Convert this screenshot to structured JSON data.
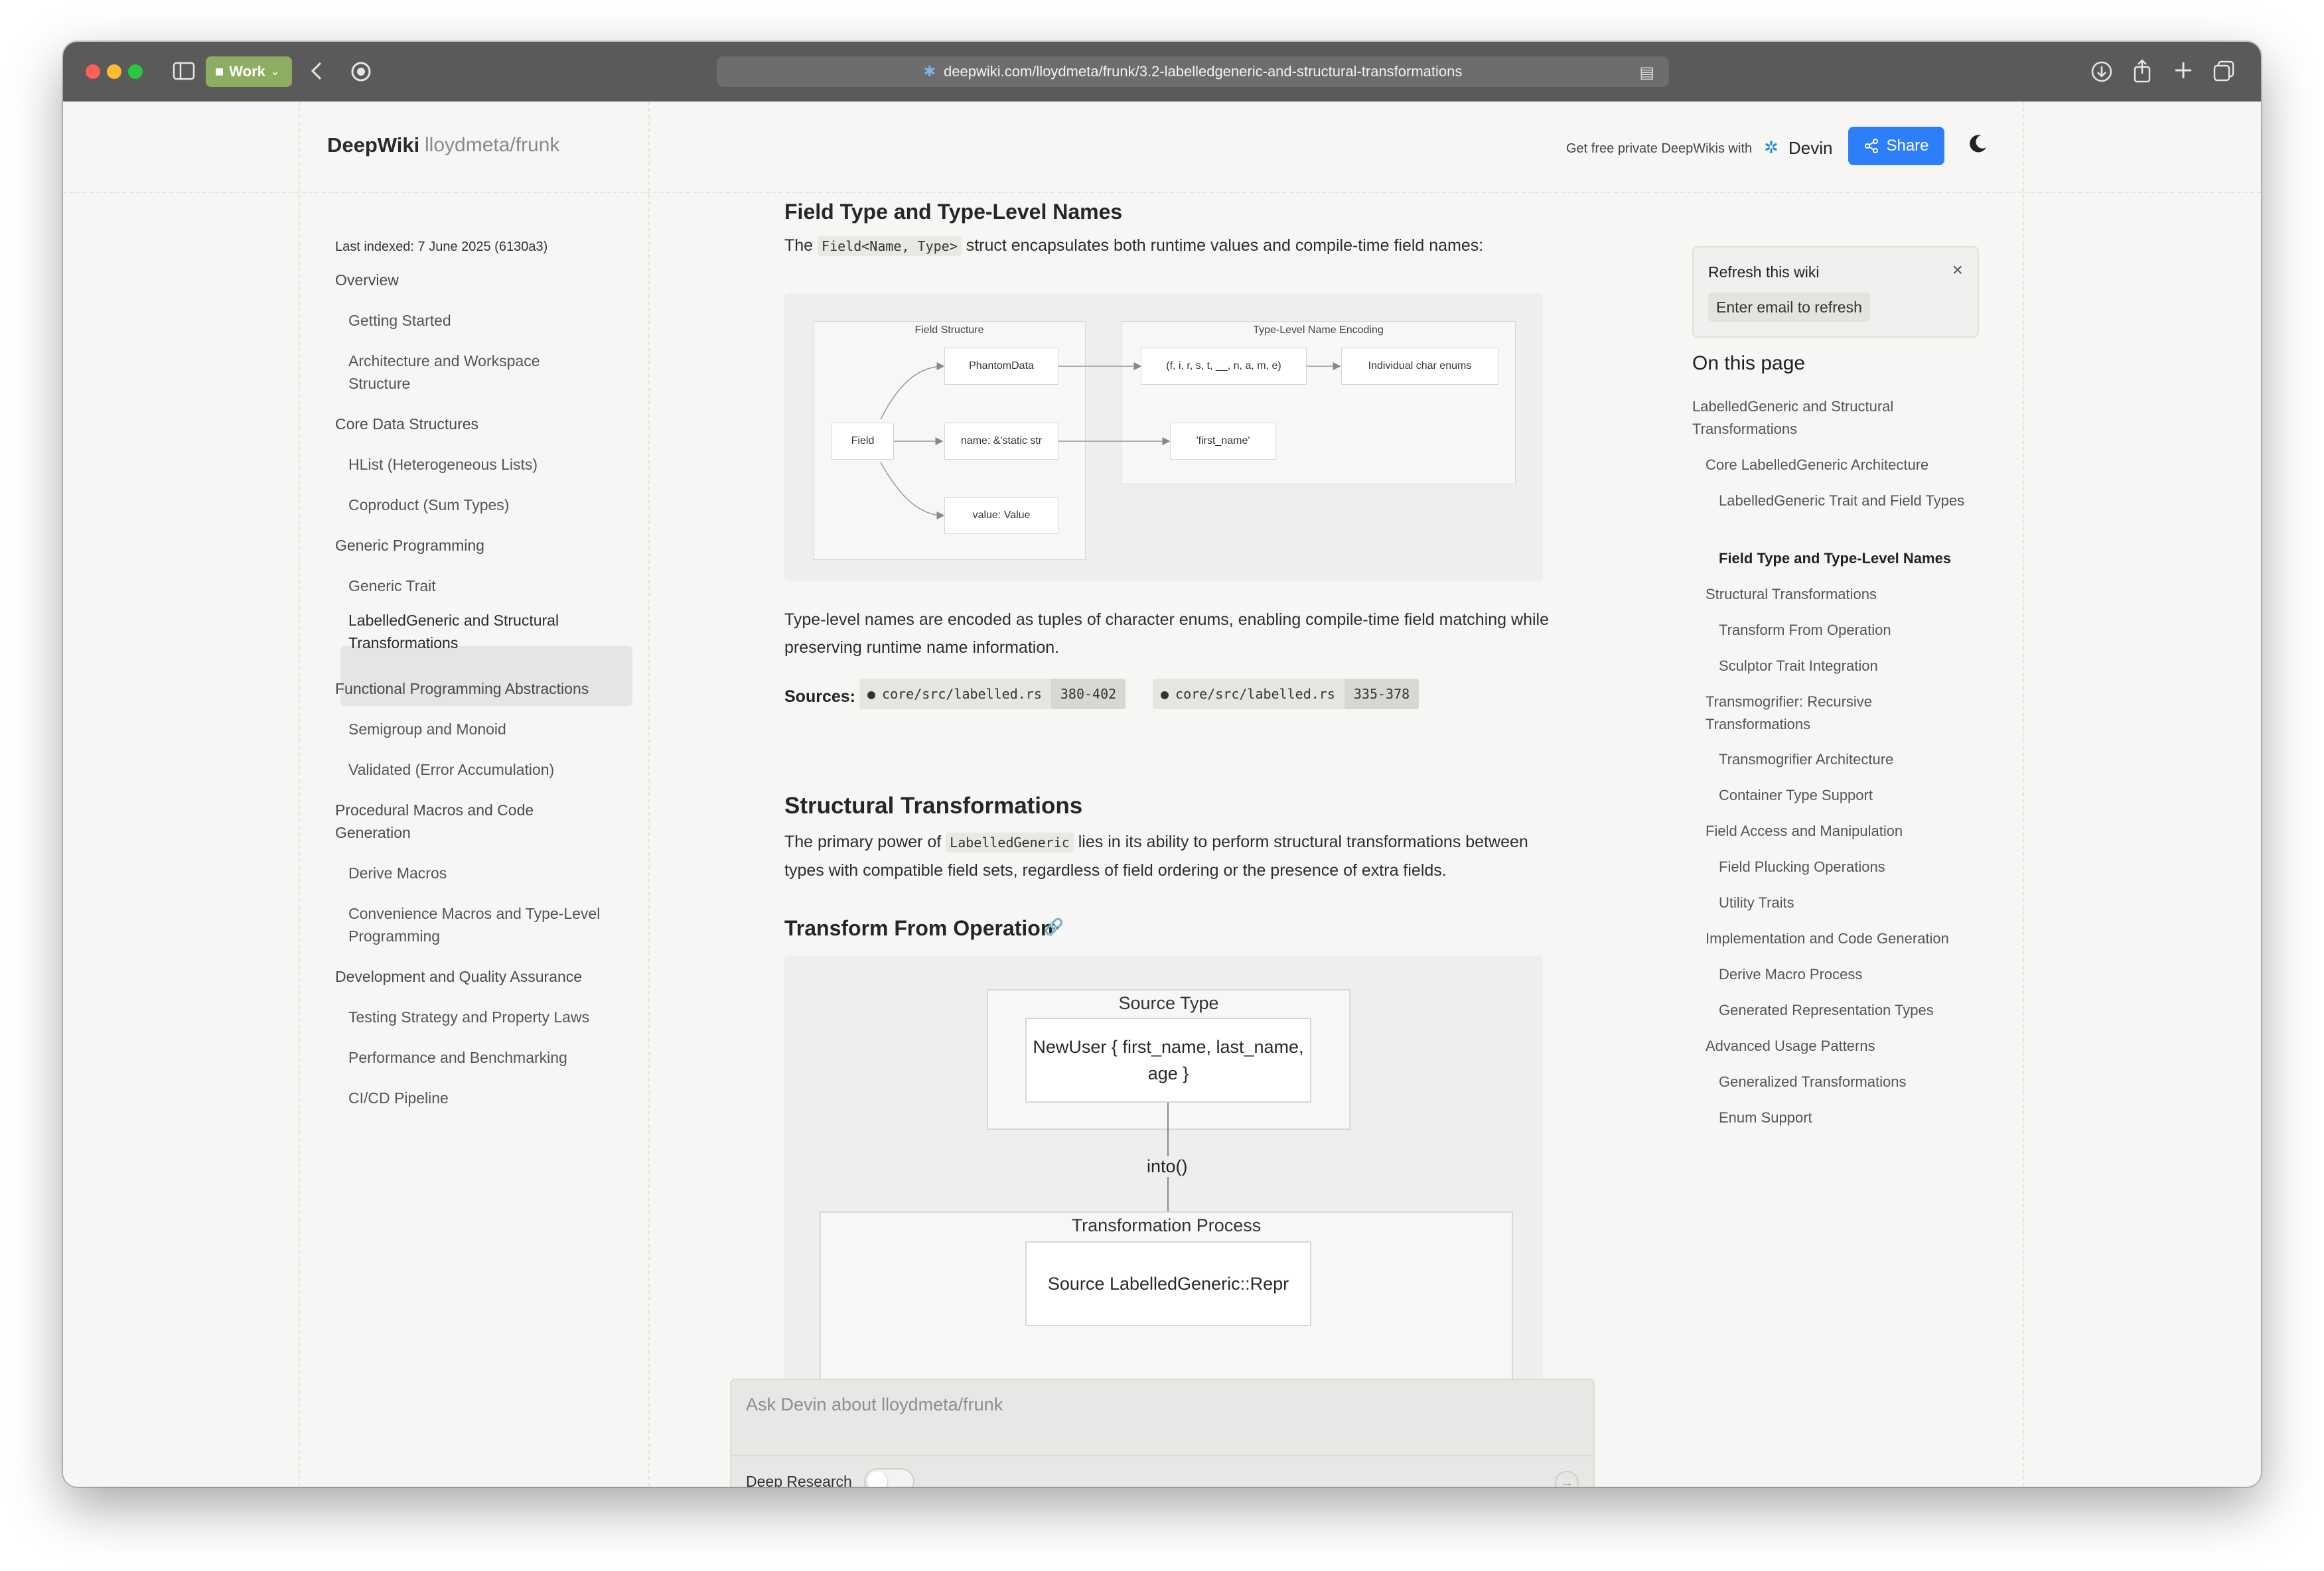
{
  "browser": {
    "profile_label": "Work",
    "url": "deepwiki.com/lloydmeta/frunk/3.2-labelledgeneric-and-structural-transformations"
  },
  "header": {
    "brand": "DeepWiki",
    "repo": "lloydmeta/frunk",
    "promo": "Get free private DeepWikis with",
    "devin": "Devin",
    "share": "Share"
  },
  "sidebar": {
    "last_indexed": "Last indexed: 7 June 2025 (6130a3)",
    "items": [
      {
        "label": "Overview"
      },
      {
        "label": "Getting Started"
      },
      {
        "label": "Architecture and Workspace Structure"
      },
      {
        "label": "Core Data Structures"
      },
      {
        "label": "HList (Heterogeneous Lists)"
      },
      {
        "label": "Coproduct (Sum Types)"
      },
      {
        "label": "Generic Programming"
      },
      {
        "label": "Generic Trait"
      },
      {
        "label": "LabelledGeneric and Structural Transformations"
      },
      {
        "label": "Functional Programming Abstractions"
      },
      {
        "label": "Semigroup and Monoid"
      },
      {
        "label": "Validated (Error Accumulation)"
      },
      {
        "label": "Procedural Macros and Code Generation"
      },
      {
        "label": "Derive Macros"
      },
      {
        "label": "Convenience Macros and Type-Level Programming"
      },
      {
        "label": "Development and Quality Assurance"
      },
      {
        "label": "Testing Strategy and Property Laws"
      },
      {
        "label": "Performance and Benchmarking"
      },
      {
        "label": "CI/CD Pipeline"
      }
    ]
  },
  "content": {
    "section1": {
      "title": "Field Type and Type-Level Names",
      "intro_pre": "The",
      "intro_code": "Field<Name, Type>",
      "intro_post": "struct encapsulates both runtime values and compile-time field names:",
      "diagram": {
        "group_field_structure": "Field Structure",
        "group_encoding": "Type-Level Name Encoding",
        "node_phantom": "PhantomData",
        "node_field": "Field",
        "node_name": "name: &'static str",
        "node_value": "value: Value",
        "node_tuple": "(f, i, r, s, t, __, n, a, m, e)",
        "node_enums": "Individual char enums",
        "node_first_name": "'first_name'"
      },
      "para": "Type-level names are encoded as tuples of character enums, enabling compile-time field matching while preserving runtime name information.",
      "sources_label": "Sources:",
      "sources": [
        {
          "file": "core/src/labelled.rs",
          "lines": "380-402"
        },
        {
          "file": "core/src/labelled.rs",
          "lines": "335-378"
        }
      ]
    },
    "section2": {
      "title": "Structural Transformations",
      "para_pre": "The primary power of",
      "para_code": "LabelledGeneric",
      "para_post": "lies in its ability to perform structural transformations between types with compatible field sets, regardless of field ordering or the presence of extra fields."
    },
    "section3": {
      "title": "Transform From Operation",
      "diagram": {
        "group_source": "Source Type",
        "node_newuser": "NewUser { first_name, last_name, age }",
        "edge_into": "into()",
        "group_process": "Transformation Process",
        "node_source_repr": "Source LabelledGeneric::Repr"
      }
    }
  },
  "ask": {
    "placeholder": "Ask Devin about lloydmeta/frunk",
    "deep_research": "Deep Research"
  },
  "right_panel": {
    "refresh_title": "Refresh this wiki",
    "refresh_button": "Enter email to refresh",
    "toc_title": "On this page",
    "toc": [
      {
        "label": "LabelledGeneric and Structural Transformations"
      },
      {
        "label": "Core LabelledGeneric Architecture"
      },
      {
        "label": "LabelledGeneric Trait and Field Types"
      },
      {
        "label": "Field Type and Type-Level Names"
      },
      {
        "label": "Structural Transformations"
      },
      {
        "label": "Transform From Operation"
      },
      {
        "label": "Sculptor Trait Integration"
      },
      {
        "label": "Transmogrifier: Recursive Transformations"
      },
      {
        "label": "Transmogrifier Architecture"
      },
      {
        "label": "Container Type Support"
      },
      {
        "label": "Field Access and Manipulation"
      },
      {
        "label": "Field Plucking Operations"
      },
      {
        "label": "Utility Traits"
      },
      {
        "label": "Implementation and Code Generation"
      },
      {
        "label": "Derive Macro Process"
      },
      {
        "label": "Generated Representation Types"
      },
      {
        "label": "Advanced Usage Patterns"
      },
      {
        "label": "Generalized Transformations"
      },
      {
        "label": "Enum Support"
      }
    ]
  },
  "colors": {
    "accent": "#2d7ff9",
    "page_bg": "#f7f6f4",
    "titlebar": "#5a5a5a"
  }
}
